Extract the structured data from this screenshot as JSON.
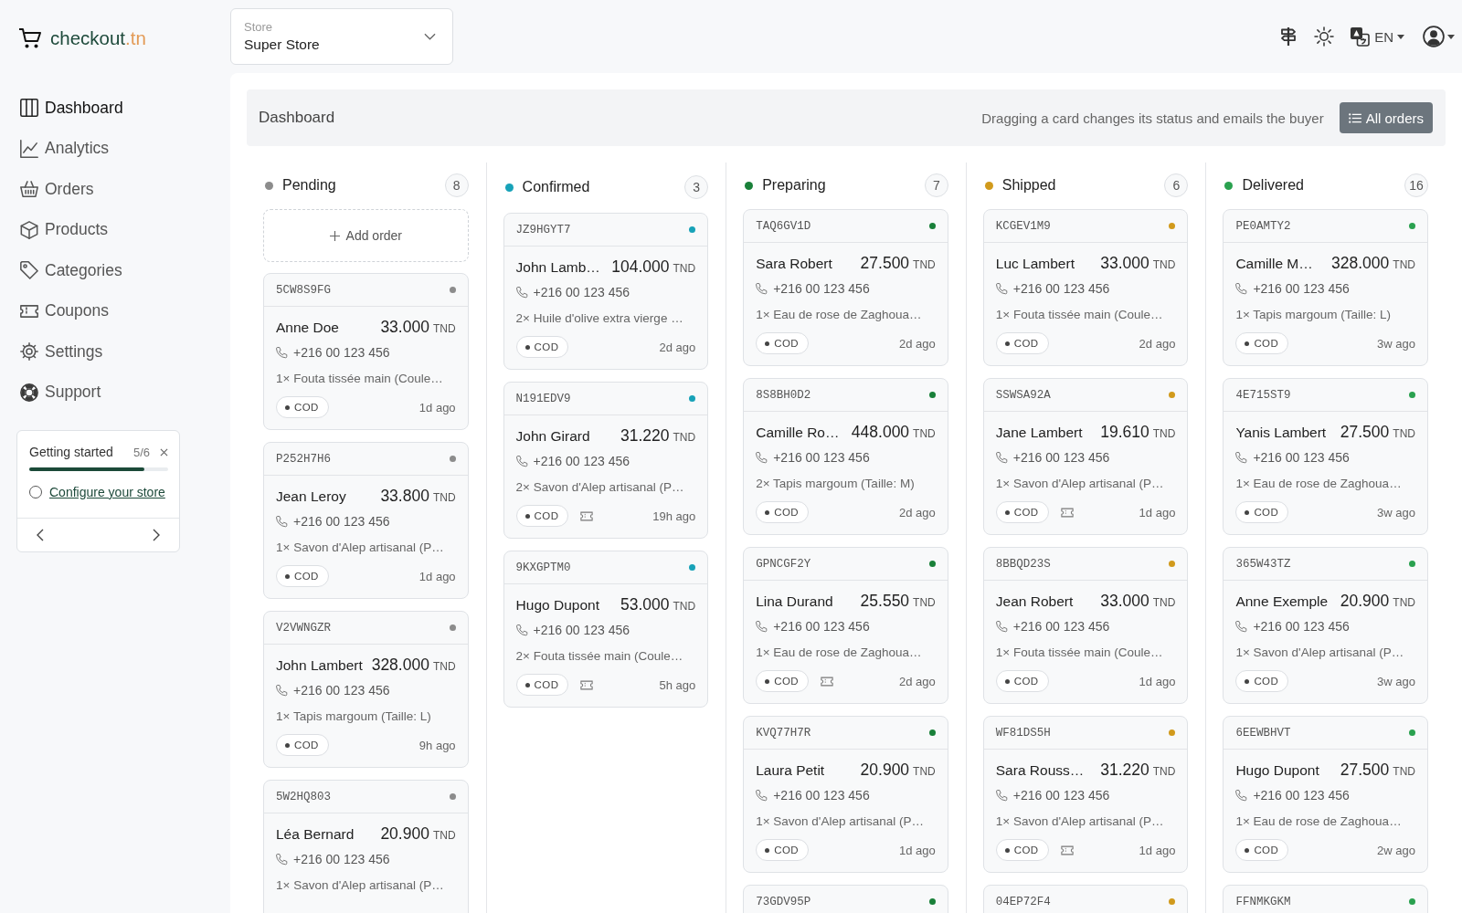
{
  "logo": {
    "name": "checkout",
    "domain": ".tn"
  },
  "store_select": {
    "label": "Store",
    "value": "Super Store"
  },
  "top_bar": {
    "language": "EN"
  },
  "sidebar": {
    "items": [
      {
        "label": "Dashboard",
        "selected": true
      },
      {
        "label": "Analytics",
        "selected": false
      },
      {
        "label": "Orders",
        "selected": false
      },
      {
        "label": "Products",
        "selected": false
      },
      {
        "label": "Categories",
        "selected": false
      },
      {
        "label": "Coupons",
        "selected": false
      },
      {
        "label": "Settings",
        "selected": false
      },
      {
        "label": "Support",
        "selected": false
      }
    ]
  },
  "getting_started": {
    "title": "Getting started",
    "progress": "5/6",
    "level": 0.83,
    "task": {
      "label": "Configure your store",
      "checked": false
    }
  },
  "page_header": {
    "title": "Dashboard",
    "hint": "Dragging a card changes its status and emails the buyer",
    "button": "All orders"
  },
  "board": {
    "columns": [
      {
        "title": "Pending",
        "count": "8",
        "color": "#8c8c8c",
        "add_order": "Add order",
        "cards": [
          {
            "id": "5CW8S9FG",
            "customer": "Anne Doe",
            "amount": "33.000",
            "currency": "TND",
            "phone": "+216 00 123 456",
            "items": "1× Fouta tissée main (Coule…",
            "payment": "COD",
            "coupon": false,
            "age": "1d ago"
          },
          {
            "id": "P252H7H6",
            "customer": "Jean Leroy",
            "amount": "33.800",
            "currency": "TND",
            "phone": "+216 00 123 456",
            "items": "1× Savon d'Alep artisanal (P…",
            "payment": "COD",
            "coupon": false,
            "age": "1d ago"
          },
          {
            "id": "V2VWNGZR",
            "customer": "John Lambert",
            "amount": "328.000",
            "currency": "TND",
            "phone": "+216 00 123 456",
            "items": "1× Tapis margoum (Taille: L)",
            "payment": "COD",
            "coupon": false,
            "age": "9h ago"
          },
          {
            "id": "5W2HQ803",
            "customer": "Léa Bernard",
            "amount": "20.900",
            "currency": "TND",
            "phone": "+216 00 123 456",
            "items": "1× Savon d'Alep artisanal (P…"
          }
        ]
      },
      {
        "title": "Confirmed",
        "count": "3",
        "color": "#17a2b8",
        "cards": [
          {
            "id": "JZ9HGYT7",
            "customer": "John Lamb…",
            "amount": "104.000",
            "currency": "TND",
            "phone": "+216 00 123 456",
            "items": "2× Huile d'olive extra vierge …",
            "payment": "COD",
            "coupon": false,
            "age": "2d ago"
          },
          {
            "id": "N191EDV9",
            "customer": "John Girard",
            "amount": "31.220",
            "currency": "TND",
            "phone": "+216 00 123 456",
            "items": "2× Savon d'Alep artisanal (P…",
            "payment": "COD",
            "coupon": true,
            "age": "19h ago"
          },
          {
            "id": "9KXGPTM0",
            "customer": "Hugo Dupont",
            "amount": "53.000",
            "currency": "TND",
            "phone": "+216 00 123 456",
            "items": "2× Fouta tissée main (Coule…",
            "payment": "COD",
            "coupon": true,
            "age": "5h ago"
          }
        ]
      },
      {
        "title": "Preparing",
        "count": "7",
        "color": "#198039",
        "cards": [
          {
            "id": "TAQ6GV1D",
            "customer": "Sara Robert",
            "amount": "27.500",
            "currency": "TND",
            "phone": "+216 00 123 456",
            "items": "1× Eau de rose de Zaghoua…",
            "payment": "COD",
            "coupon": false,
            "age": "2d ago"
          },
          {
            "id": "8S8BH0D2",
            "customer": "Camille Ro…",
            "amount": "448.000",
            "currency": "TND",
            "phone": "+216 00 123 456",
            "items": "2× Tapis margoum (Taille: M)",
            "payment": "COD",
            "coupon": false,
            "age": "2d ago"
          },
          {
            "id": "GPNCGF2Y",
            "customer": "Lina Durand",
            "amount": "25.550",
            "currency": "TND",
            "phone": "+216 00 123 456",
            "items": "1× Eau de rose de Zaghoua…",
            "payment": "COD",
            "coupon": true,
            "age": "2d ago"
          },
          {
            "id": "KVQ77H7R",
            "customer": "Laura Petit",
            "amount": "20.900",
            "currency": "TND",
            "phone": "+216 00 123 456",
            "items": "1× Savon d'Alep artisanal (P…",
            "payment": "COD",
            "coupon": false,
            "age": "1d ago"
          },
          {
            "id": "73GDV95P"
          }
        ]
      },
      {
        "title": "Shipped",
        "count": "6",
        "color": "#d19a1c",
        "cards": [
          {
            "id": "KCGEV1M9",
            "customer": "Luc Lambert",
            "amount": "33.000",
            "currency": "TND",
            "phone": "+216 00 123 456",
            "items": "1× Fouta tissée main (Coule…",
            "payment": "COD",
            "coupon": false,
            "age": "2d ago"
          },
          {
            "id": "SSWSA92A",
            "customer": "Jane Lambert",
            "amount": "19.610",
            "currency": "TND",
            "phone": "+216 00 123 456",
            "items": "1× Savon d'Alep artisanal (P…",
            "payment": "COD",
            "coupon": true,
            "age": "1d ago"
          },
          {
            "id": "8BBQD23S",
            "customer": "Jean Robert",
            "amount": "33.000",
            "currency": "TND",
            "phone": "+216 00 123 456",
            "items": "1× Fouta tissée main (Coule…",
            "payment": "COD",
            "coupon": false,
            "age": "1d ago"
          },
          {
            "id": "WF81DS5H",
            "customer": "Sara Rouss…",
            "amount": "31.220",
            "currency": "TND",
            "phone": "+216 00 123 456",
            "items": "1× Savon d'Alep artisanal (P…",
            "payment": "COD",
            "coupon": true,
            "age": "1d ago"
          },
          {
            "id": "04EP72F4"
          }
        ]
      },
      {
        "title": "Delivered",
        "count": "16",
        "color": "#2aa14f",
        "cards": [
          {
            "id": "PE0AMTY2",
            "customer": "Camille M…",
            "amount": "328.000",
            "currency": "TND",
            "phone": "+216 00 123 456",
            "items": "1× Tapis margoum (Taille: L)",
            "payment": "COD",
            "coupon": false,
            "age": "3w ago"
          },
          {
            "id": "4E715ST9",
            "customer": "Yanis Lambert",
            "amount": "27.500",
            "currency": "TND",
            "phone": "+216 00 123 456",
            "items": "1× Eau de rose de Zaghoua…",
            "payment": "COD",
            "coupon": false,
            "age": "3w ago"
          },
          {
            "id": "365W43TZ",
            "customer": "Anne Exemple",
            "amount": "20.900",
            "currency": "TND",
            "phone": "+216 00 123 456",
            "items": "1× Savon d'Alep artisanal (P…",
            "payment": "COD",
            "coupon": false,
            "age": "3w ago"
          },
          {
            "id": "6EEWBHVT",
            "customer": "Hugo Dupont",
            "amount": "27.500",
            "currency": "TND",
            "phone": "+216 00 123 456",
            "items": "1× Eau de rose de Zaghoua…",
            "payment": "COD",
            "coupon": false,
            "age": "2w ago"
          },
          {
            "id": "FFNMKGKM"
          }
        ]
      }
    ]
  }
}
